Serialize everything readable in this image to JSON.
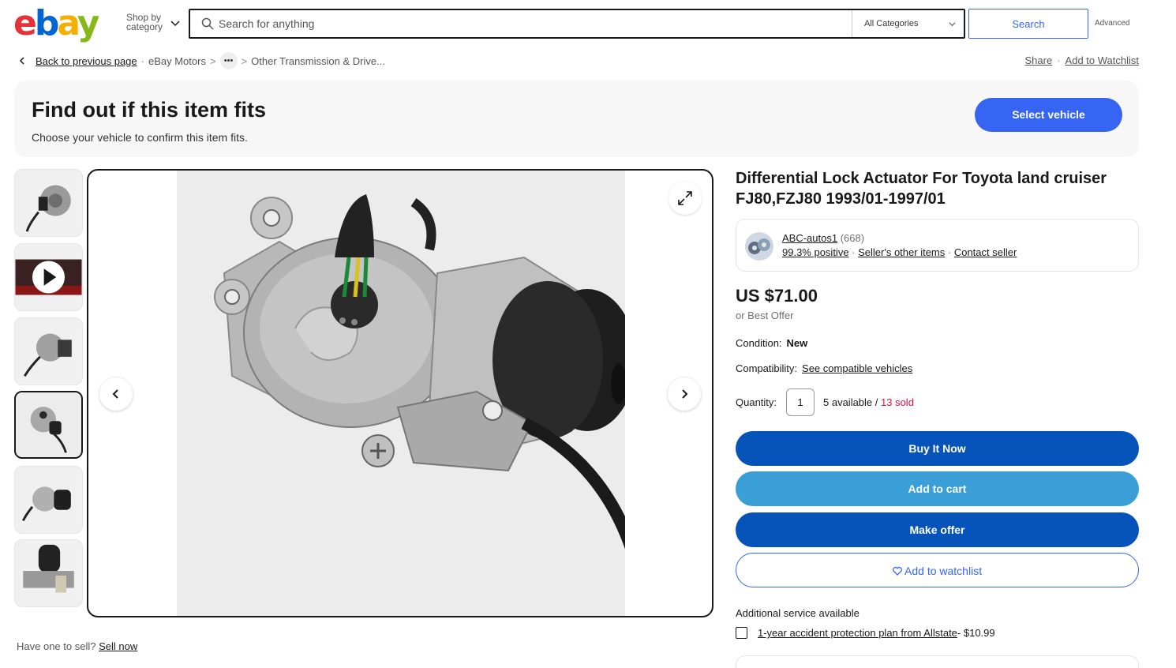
{
  "header": {
    "logo": {
      "e": "e",
      "b": "b",
      "a": "a",
      "y": "y"
    },
    "shop_by_line1": "Shop by",
    "shop_by_line2": "category",
    "search_placeholder": "Search for anything",
    "category": "All Categories",
    "search_button": "Search",
    "advanced": "Advanced"
  },
  "breadcrumb": {
    "back": "Back to previous page",
    "items": [
      "eBay Motors",
      "Other Transmission & Drive..."
    ],
    "more": "•••",
    "share": "Share",
    "watchlist": "Add to Watchlist"
  },
  "fits": {
    "title": "Find out if this item fits",
    "subtitle": "Choose your vehicle to confirm this item fits.",
    "button": "Select vehicle"
  },
  "gallery": {
    "thumbnail_count": 6,
    "active_index": 3
  },
  "sell": {
    "prefix": "Have one to sell?",
    "link": "Sell now"
  },
  "item": {
    "title": "Differential Lock Actuator For Toyota land cruiser FJ80,FZJ80 1993/01-1997/01",
    "seller": {
      "name": "ABC-autos1",
      "count": "(668)",
      "positive": "99.3% positive",
      "other_items": "Seller's other items",
      "contact": "Contact seller"
    },
    "price": "US $71.00",
    "best_offer": "or Best Offer",
    "condition_label": "Condition:",
    "condition_value": "New",
    "compat_label": "Compatibility:",
    "compat_link": "See compatible vehicles",
    "qty_label": "Quantity:",
    "qty_value": "1",
    "available": "5 available / ",
    "sold": "13 sold",
    "buy_now": "Buy It Now",
    "add_cart": "Add to cart",
    "make_offer": "Make offer",
    "add_watch": "Add to watchlist",
    "additional": "Additional service available",
    "plan_link": "1-year accident protection plan from Allstate",
    "plan_price": " - $10.99"
  },
  "colors": {
    "primary_blue": "#0654ba",
    "cart_blue": "#3a9fd6",
    "accent": "#3665f3",
    "sold_red": "#e0103a"
  }
}
